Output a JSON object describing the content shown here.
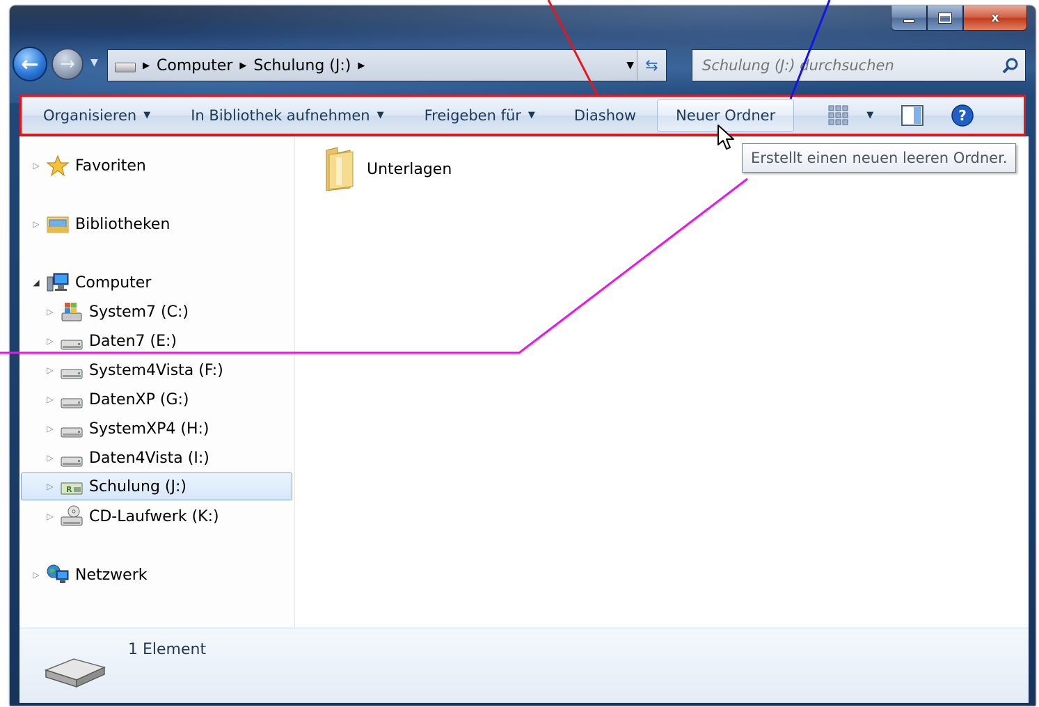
{
  "window": {
    "caption_buttons": {
      "minimize": "–",
      "maximize": "□",
      "close": "x"
    }
  },
  "nav": {
    "back_icon": "back-arrow-icon",
    "forward_icon": "forward-arrow-icon",
    "breadcrumb": [
      "Computer",
      "Schulung (J:)"
    ],
    "search_placeholder": "Schulung (J:) durchsuchen"
  },
  "toolbar": {
    "organize": "Organisieren",
    "include_library": "In Bibliothek aufnehmen",
    "share_with": "Freigeben für",
    "slideshow": "Diashow",
    "new_folder": "Neuer Ordner"
  },
  "tooltip": {
    "text": "Erstellt einen neuen leeren Ordner."
  },
  "navpane": {
    "favorites": "Favoriten",
    "libraries": "Bibliotheken",
    "computer": "Computer",
    "drives": [
      {
        "label": "System7 (C:)",
        "icon": "windows-drive-icon"
      },
      {
        "label": "Daten7 (E:)",
        "icon": "hard-drive-icon"
      },
      {
        "label": "System4Vista (F:)",
        "icon": "hard-drive-icon"
      },
      {
        "label": "DatenXP (G:)",
        "icon": "hard-drive-icon"
      },
      {
        "label": "SystemXP4 (H:)",
        "icon": "hard-drive-icon"
      },
      {
        "label": "Daten4Vista (I:)",
        "icon": "hard-drive-icon"
      },
      {
        "label": "Schulung (J:)",
        "icon": "removable-drive-icon"
      },
      {
        "label": "CD-Laufwerk (K:)",
        "icon": "cd-drive-icon"
      }
    ],
    "network": "Netzwerk"
  },
  "files": [
    {
      "name": "Unterlagen",
      "icon": "folder-icon"
    }
  ],
  "details": {
    "count": "1 Element"
  },
  "colors": {
    "annotation_red": "#e8161c",
    "annotation_blue": "#1414e8",
    "annotation_magenta": "#ee12ee"
  }
}
